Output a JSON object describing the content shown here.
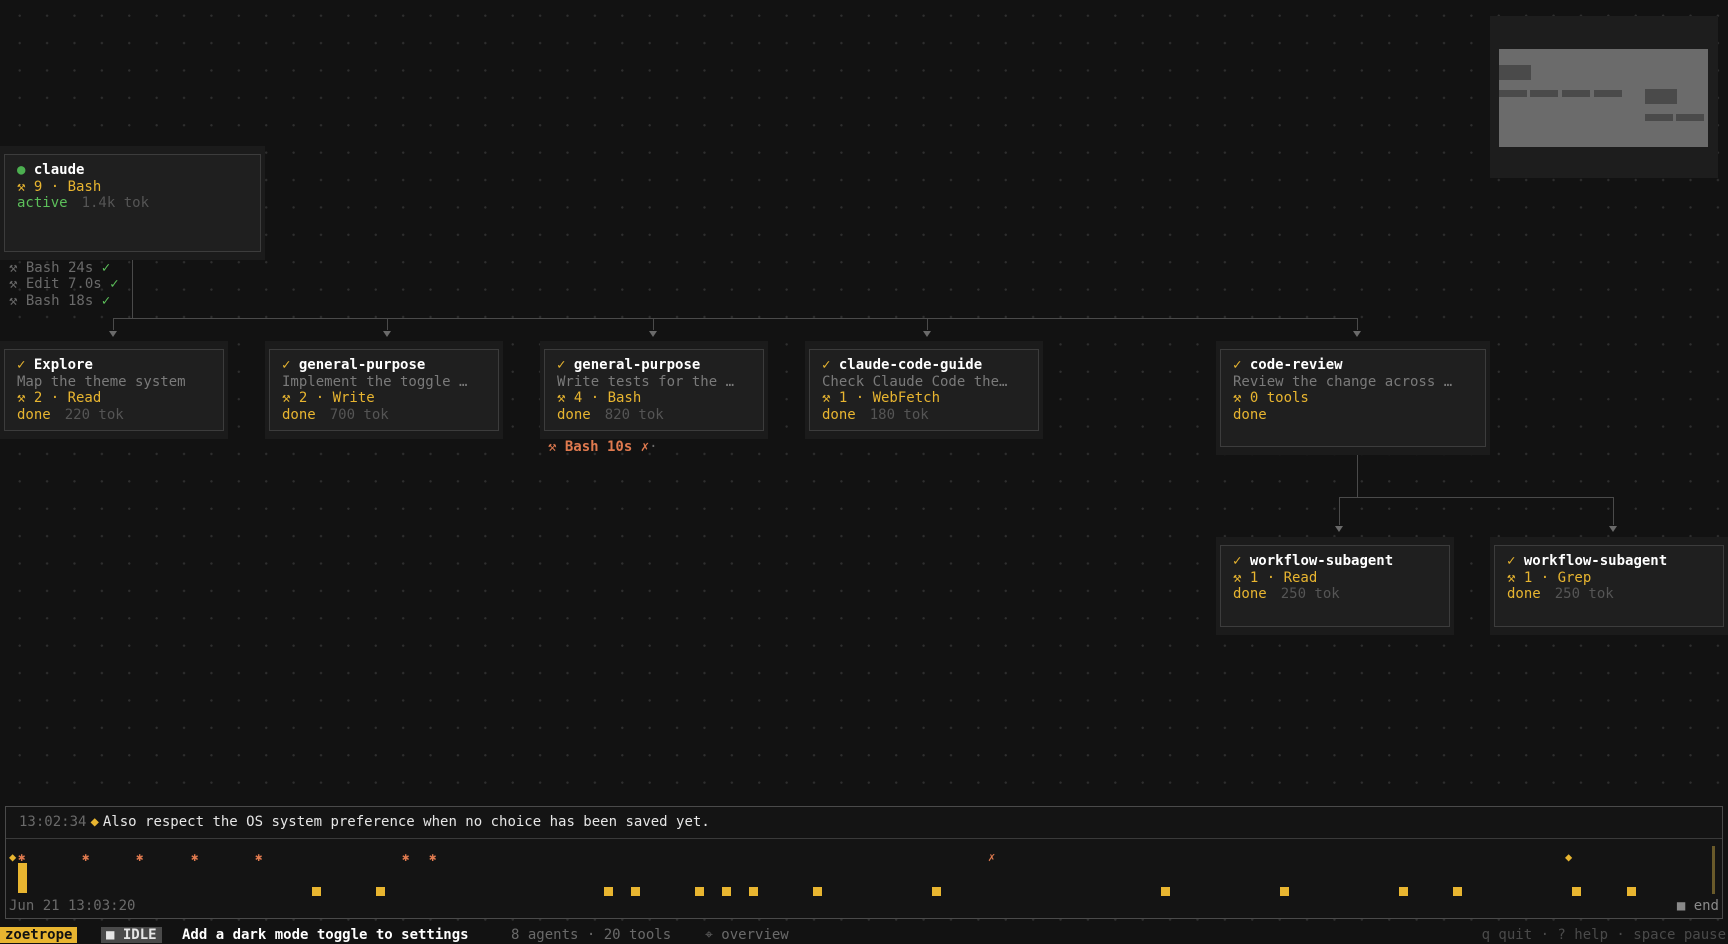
{
  "nodes": {
    "root": {
      "status_icon": "●",
      "title": "claude",
      "tools": "⚒ 9 · Bash",
      "status": "active",
      "tokens": "1.4k tok"
    },
    "explore": {
      "status_icon": "✓",
      "title": "Explore",
      "desc": "Map the theme system",
      "tools": "⚒ 2 · Read",
      "status": "done",
      "tokens": "220 tok"
    },
    "gp1": {
      "status_icon": "✓",
      "title": "general-purpose",
      "desc": "Implement the toggle …",
      "tools": "⚒ 2 · Write",
      "status": "done",
      "tokens": "700 tok"
    },
    "gp2": {
      "status_icon": "✓",
      "title": "general-purpose",
      "desc": "Write tests for the …",
      "tools": "⚒ 4 · Bash",
      "status": "done",
      "tokens": "820 tok"
    },
    "guide": {
      "status_icon": "✓",
      "title": "claude-code-guide",
      "desc": "Check Claude Code the…",
      "tools": "⚒ 1 · WebFetch",
      "status": "done",
      "tokens": "180 tok"
    },
    "review": {
      "status_icon": "✓",
      "title": "code-review",
      "desc": "Review the change across …",
      "tools": "⚒ 0 tools",
      "status": "done"
    },
    "wf1": {
      "status_icon": "✓",
      "title": "workflow-subagent",
      "tools": "⚒ 1 · Read",
      "status": "done",
      "tokens": "250 tok"
    },
    "wf2": {
      "status_icon": "✓",
      "title": "workflow-subagent",
      "tools": "⚒ 1 · Grep",
      "status": "done",
      "tokens": "250 tok"
    }
  },
  "root_tool_runs": [
    {
      "label": "⚒ Bash 24s",
      "result": "✓"
    },
    {
      "label": "⚒ Edit 7.0s",
      "result": "✓"
    },
    {
      "label": "⚒ Bash 18s",
      "result": "✓"
    }
  ],
  "failed_run": {
    "label": "⚒ Bash 10s ✗",
    "trail": "·"
  },
  "timeline": {
    "time": "13:02:34",
    "diamond": "◆",
    "message": "Also respect the OS system preference when no choice has been saved yet.",
    "date": "Jun 21 13:03:20",
    "end_label": "■ end",
    "start_marker": "◆",
    "error_marker": "✗",
    "spawn_marker": "✱",
    "late_marker": "◆"
  },
  "statusbar": {
    "app": "zoetrope",
    "state": "■ IDLE",
    "prompt": "Add a dark mode toggle to settings",
    "counts": "8 agents · 20 tools",
    "overview": "⌖ overview",
    "keys": "q quit · ? help · space pause"
  },
  "colors": {
    "accent": "#e8b530",
    "active": "#5cbf5a",
    "error": "#e07a4f",
    "background": "#121212"
  }
}
